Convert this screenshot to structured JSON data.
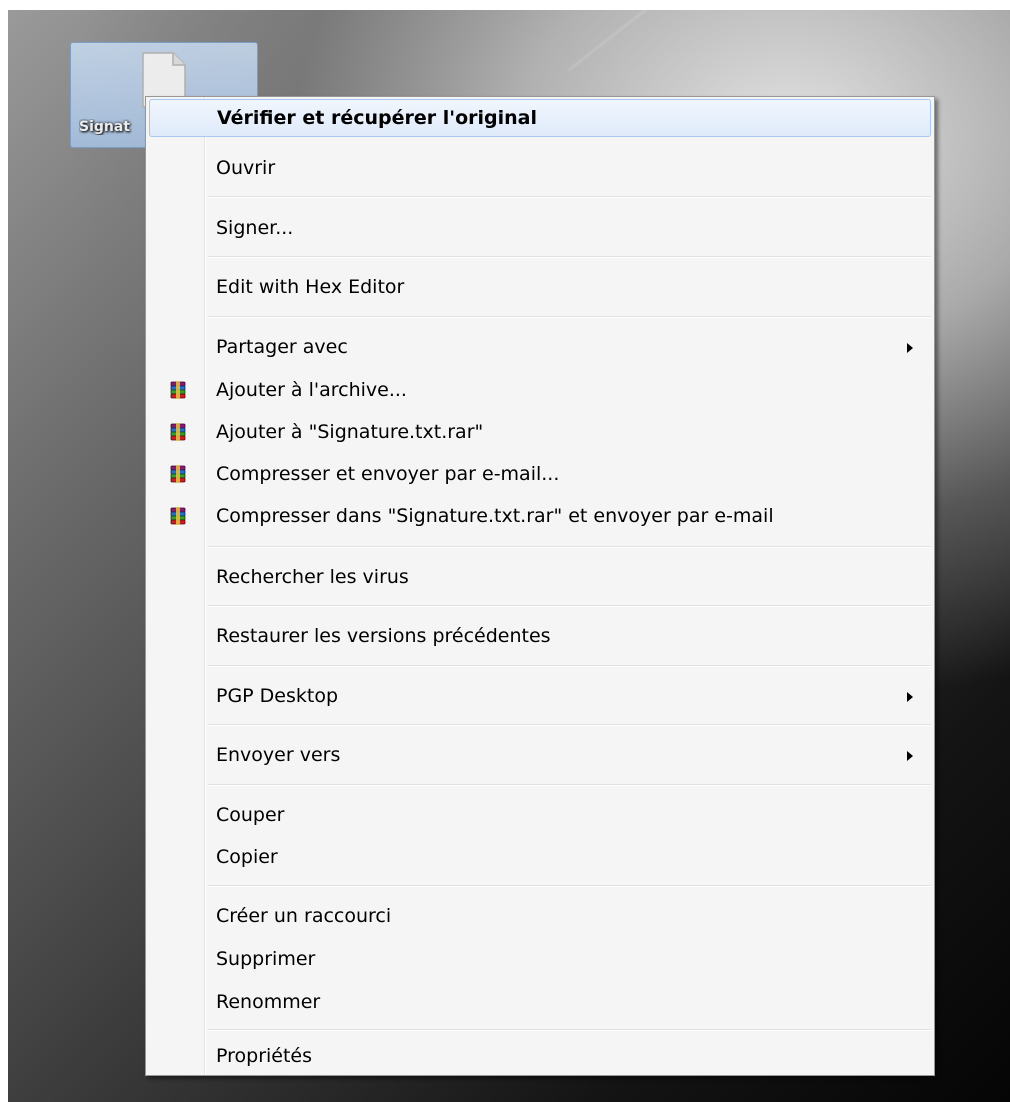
{
  "desktop": {
    "file": {
      "name": "Signature.txt",
      "visible_name": "Signat",
      "icon": "text-file-icon"
    }
  },
  "context_menu": {
    "items": [
      {
        "label": "Vérifier et récupérer l'original",
        "bold": true,
        "highlighted": true
      },
      {
        "label": "Ouvrir"
      },
      {
        "label": "Signer..."
      },
      {
        "label": "Edit with Hex Editor"
      },
      {
        "label": "Partager avec",
        "submenu": true
      },
      {
        "label": "Ajouter à l'archive...",
        "icon": "winrar-icon"
      },
      {
        "label": "Ajouter à \"Signature.txt.rar\"",
        "icon": "winrar-icon"
      },
      {
        "label": "Compresser et envoyer par e-mail...",
        "icon": "winrar-icon"
      },
      {
        "label": "Compresser dans \"Signature.txt.rar\" et envoyer par e-mail",
        "icon": "winrar-icon"
      },
      {
        "label": "Rechercher les virus"
      },
      {
        "label": "Restaurer les versions précédentes"
      },
      {
        "label": "PGP Desktop",
        "submenu": true
      },
      {
        "label": "Envoyer vers",
        "submenu": true
      },
      {
        "label": "Couper"
      },
      {
        "label": "Copier"
      },
      {
        "label": "Créer un raccourci"
      },
      {
        "label": "Supprimer"
      },
      {
        "label": "Renommer"
      },
      {
        "label": "Propriétés"
      }
    ]
  }
}
